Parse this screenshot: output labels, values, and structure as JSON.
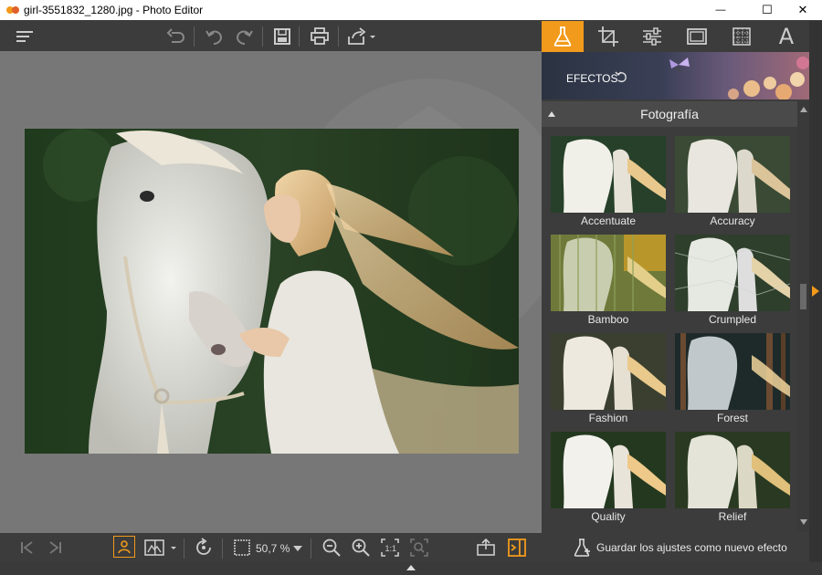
{
  "window": {
    "title": "girl-3551832_1280.jpg - Photo Editor",
    "minimize_glyph": "—",
    "maximize_glyph": "☐",
    "close_glyph": "✕"
  },
  "toolbar": {
    "icons": [
      "menu-icon",
      "undo-all-icon",
      "undo-icon",
      "redo-icon",
      "save-icon",
      "print-icon",
      "share-icon"
    ]
  },
  "right_panel": {
    "tabs": [
      "effects-tab",
      "crop-tab",
      "adjust-tab",
      "frames-tab",
      "texture-tab",
      "text-tab"
    ],
    "text_tab_glyph": "A",
    "effects_label": "EFECTOS",
    "section_title": "Fotografía",
    "thumbnails": [
      {
        "label": "Accentuate"
      },
      {
        "label": "Accuracy"
      },
      {
        "label": "Bamboo"
      },
      {
        "label": "Crumpled"
      },
      {
        "label": "Fashion"
      },
      {
        "label": "Forest"
      },
      {
        "label": "Quality"
      },
      {
        "label": "Relief"
      }
    ],
    "save_effect_label": "Guardar los ajustes como nuevo efecto"
  },
  "statusbar": {
    "zoom": "50,7 %"
  },
  "colors": {
    "accent": "#f19a1b",
    "panel": "#3c3c3c",
    "canvas": "#777777"
  }
}
